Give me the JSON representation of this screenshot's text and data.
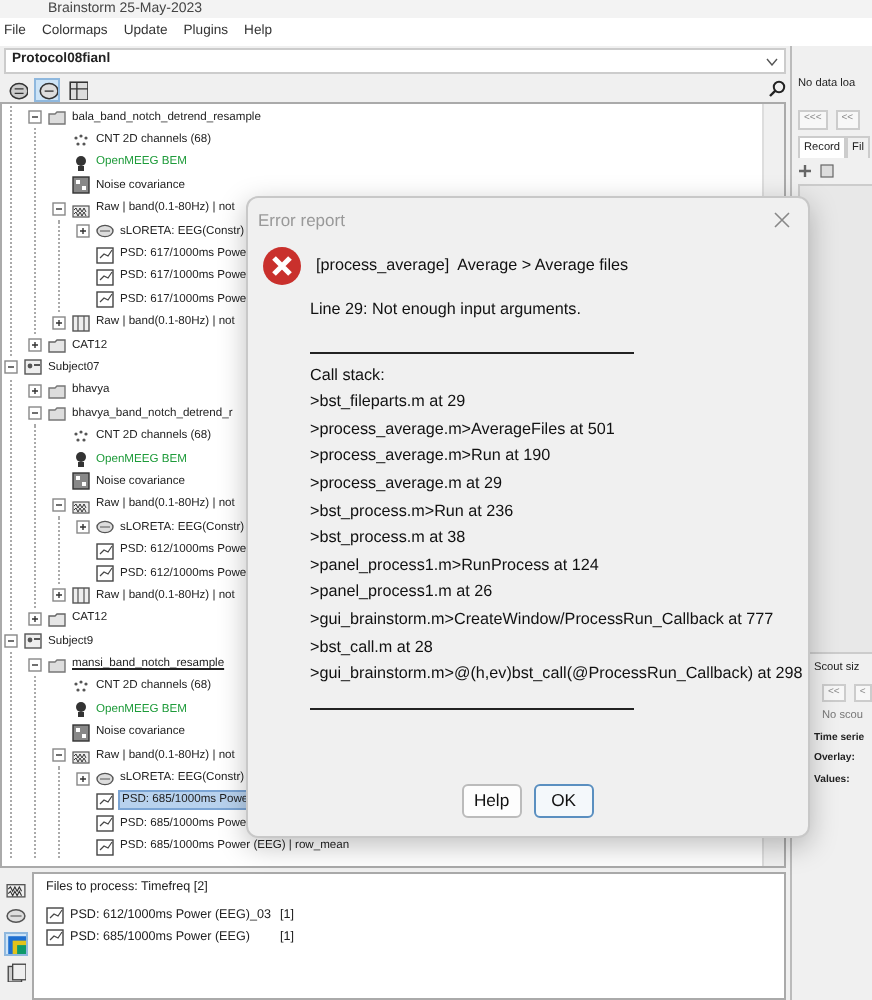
{
  "window": {
    "title": "Brainstorm 25-May-2023"
  },
  "menu": [
    "File",
    "Colormaps",
    "Update",
    "Plugins",
    "Help"
  ],
  "protocol": {
    "value": "Protocol08fianl"
  },
  "toolbar": [
    {
      "kind": "subjects",
      "selected": false
    },
    {
      "kind": "conditions",
      "selected": true
    },
    {
      "kind": "functional",
      "selected": false
    }
  ],
  "tree": [
    {
      "kind": "continued",
      "children": [
        {
          "kind": "condition",
          "label": "bala_band_notch_detrend_resample",
          "expanded": true,
          "selected": false,
          "children": [
            {
              "kind": "channels",
              "label": "CNT 2D channels (68)",
              "selected": false
            },
            {
              "kind": "headmodel",
              "label": "OpenMEEG BEM",
              "selected": false
            },
            {
              "kind": "noisecov",
              "label": "Noise covariance",
              "selected": false
            },
            {
              "kind": "raw",
              "label": "Raw | band(0.1-80Hz) | not",
              "expanded": true,
              "selected": false,
              "children": [
                {
                  "kind": "sources",
                  "label": "sLORETA: EEG(Constr)",
                  "expanded": false,
                  "selected": false
                },
                {
                  "kind": "psd",
                  "label": "PSD: 617/1000ms Powe",
                  "selected": false
                },
                {
                  "kind": "psd",
                  "label": "PSD: 617/1000ms Powe",
                  "selected": false
                },
                {
                  "kind": "psd",
                  "label": "PSD: 617/1000ms Powe",
                  "selected": false
                }
              ]
            },
            {
              "kind": "rawlink",
              "label": "Raw | band(0.1-80Hz) | not",
              "expanded": false,
              "selected": false
            }
          ]
        },
        {
          "kind": "anatomy",
          "label": "CAT12",
          "expanded": false,
          "selected": false
        }
      ]
    },
    {
      "kind": "subject",
      "label": "Subject07",
      "expanded": true,
      "selected": false,
      "children": [
        {
          "kind": "condition",
          "label": "bhavya",
          "expanded": false,
          "selected": false
        },
        {
          "kind": "condition",
          "label": "bhavya_band_notch_detrend_r",
          "expanded": true,
          "selected": false,
          "children": [
            {
              "kind": "channels",
              "label": "CNT 2D channels (68)",
              "selected": false
            },
            {
              "kind": "headmodel",
              "label": "OpenMEEG BEM",
              "selected": false
            },
            {
              "kind": "noisecov",
              "label": "Noise covariance",
              "selected": false
            },
            {
              "kind": "raw",
              "label": "Raw | band(0.1-80Hz) | not",
              "expanded": true,
              "selected": false,
              "children": [
                {
                  "kind": "sources",
                  "label": "sLORETA: EEG(Constr)",
                  "expanded": false,
                  "selected": false
                },
                {
                  "kind": "psd",
                  "label": "PSD: 612/1000ms Powe",
                  "selected": false
                },
                {
                  "kind": "psd",
                  "label": "PSD: 612/1000ms Powe",
                  "selected": false
                }
              ]
            },
            {
              "kind": "rawlink",
              "label": "Raw | band(0.1-80Hz) | not",
              "expanded": false,
              "selected": false
            }
          ]
        },
        {
          "kind": "anatomy",
          "label": "CAT12",
          "expanded": false,
          "selected": false
        }
      ]
    },
    {
      "kind": "subject",
      "label": "Subject9",
      "expanded": true,
      "selected": false,
      "children": [
        {
          "kind": "condition",
          "label": "mansi_band_notch_resample",
          "expanded": true,
          "selected": false,
          "current": true,
          "children": [
            {
              "kind": "channels",
              "label": "CNT 2D channels (68)",
              "selected": false
            },
            {
              "kind": "headmodel",
              "label": "OpenMEEG BEM",
              "selected": false
            },
            {
              "kind": "noisecov",
              "label": "Noise covariance",
              "selected": false
            },
            {
              "kind": "raw",
              "label": "Raw | band(0.1-80Hz) | not",
              "expanded": true,
              "selected": false,
              "children": [
                {
                  "kind": "sources",
                  "label": "sLORETA: EEG(Constr)",
                  "expanded": false,
                  "selected": false
                },
                {
                  "kind": "psd",
                  "label": "PSD: 685/1000ms Powe",
                  "selected": true
                },
                {
                  "kind": "psd",
                  "label": "PSD: 685/1000ms Powe",
                  "selected": false
                },
                {
                  "kind": "psd",
                  "label": "PSD: 685/1000ms Power (EEG) | row_mean",
                  "selected": false
                }
              ]
            }
          ]
        }
      ]
    }
  ],
  "process_tools": [
    {
      "kind": "raw",
      "selected": false
    },
    {
      "kind": "sources",
      "selected": false
    },
    {
      "kind": "timefreq",
      "selected": true
    },
    {
      "kind": "matrix",
      "selected": false
    }
  ],
  "files_to_process": {
    "title": "Files to process: Timefreq [2]",
    "files": [
      {
        "name": "PSD: 612/1000ms Power (EEG)_03",
        "count": "[1]"
      },
      {
        "name": "PSD: 685/1000ms Power (EEG)",
        "count": "[1]"
      }
    ]
  },
  "right_panel": {
    "status": "No data loa",
    "nav_buttons": [
      "<<<",
      "<<"
    ],
    "tabs": [
      {
        "label": "Record",
        "selected": true
      },
      {
        "label": "Fil",
        "selected": false
      }
    ],
    "scout_label": "Scout siz",
    "scout_buttons": [
      "<<",
      "<"
    ],
    "scout_status": "No scou",
    "fields": [
      "Time serie",
      "Overlay:",
      "Values:"
    ]
  },
  "dialog": {
    "title": "Error report",
    "heading": "[process_average]  Average > Average files",
    "message": "Line 29: Not enough input arguments.",
    "stack_title": "Call stack:",
    "stack": [
      ">bst_fileparts.m at 29",
      ">process_average.m>AverageFiles at 501",
      ">process_average.m>Run at 190",
      ">process_average.m at 29",
      ">bst_process.m>Run at 236",
      ">bst_process.m at 38",
      ">panel_process1.m>RunProcess at 124",
      ">panel_process1.m at 26",
      ">gui_brainstorm.m>CreateWindow/ProcessRun_Callback at 777",
      ">bst_call.m at 28",
      ">gui_brainstorm.m>@(h,ev)bst_call(@ProcessRun_Callback) at 298"
    ],
    "buttons": [
      {
        "label": "Help",
        "default": false
      },
      {
        "label": "OK",
        "default": true
      }
    ]
  }
}
